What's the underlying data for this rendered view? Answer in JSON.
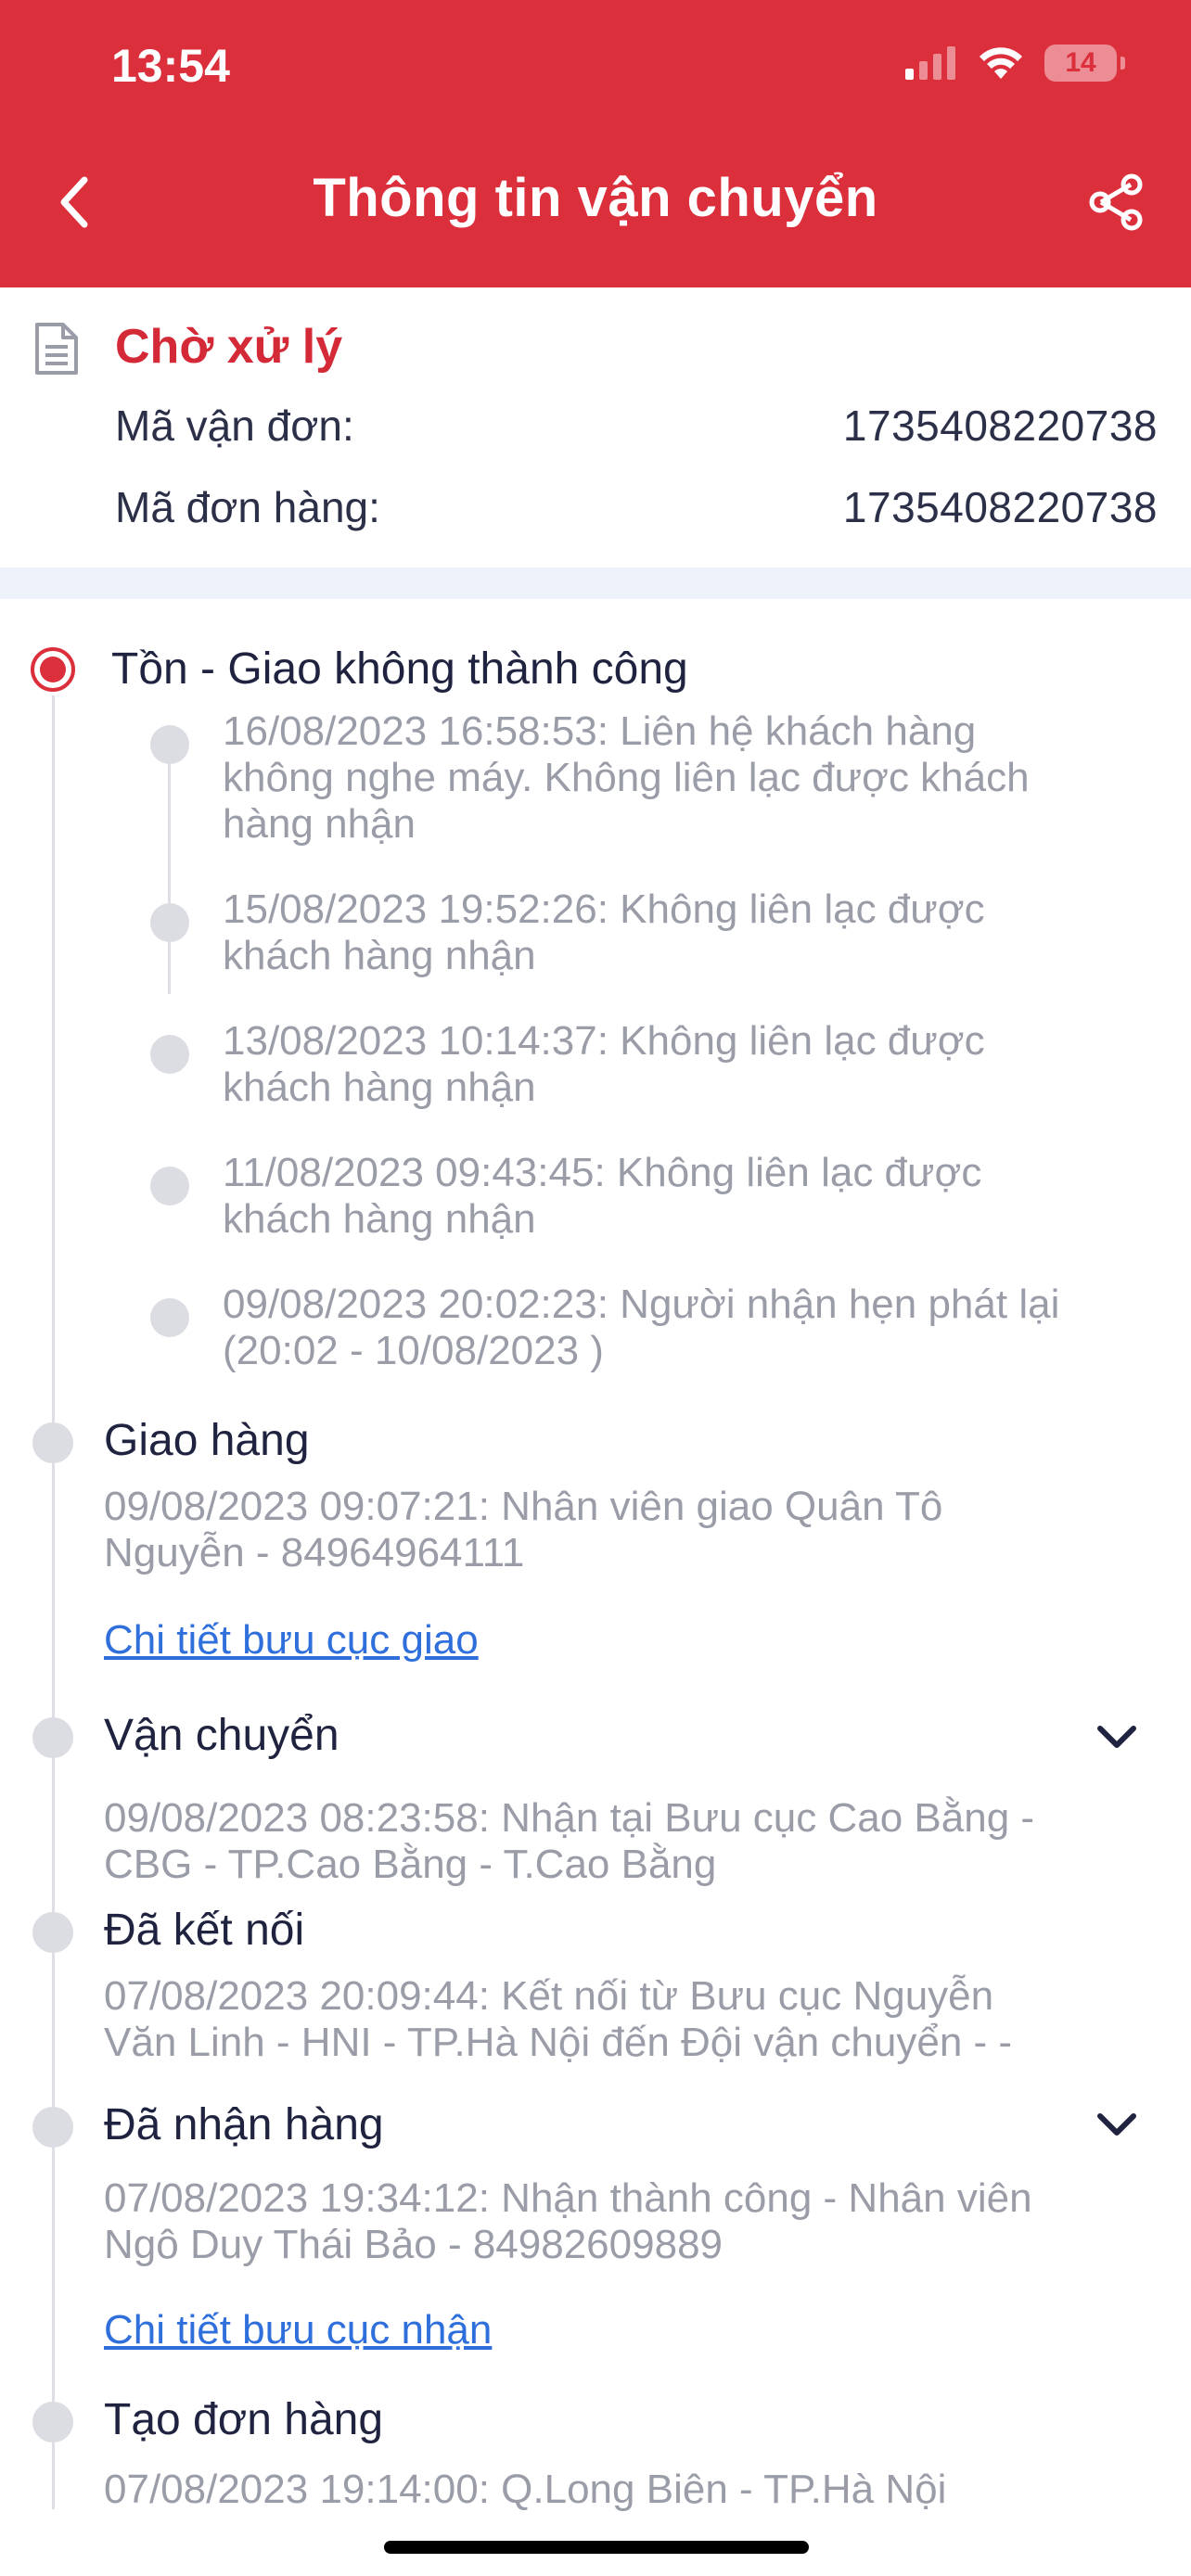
{
  "status_bar": {
    "time": "13:54",
    "battery": "14",
    "battery_level": 0.14
  },
  "header": {
    "title": "Thông tin vận chuyển",
    "accent_color": "#dc2f3c"
  },
  "order": {
    "status": "Chờ xử lý",
    "waybill_label": "Mã vận đơn:",
    "waybill_value": "1735408220738",
    "order_label": "Mã đơn hàng:",
    "order_value": "1735408220738"
  },
  "timeline": {
    "failed": {
      "title": "Tồn - Giao không thành công",
      "events": [
        {
          "line1": "16/08/2023 16:58:53: Liên hệ khách hàng",
          "line2": "không nghe máy. Không liên lạc được khách",
          "line3": "hàng nhận"
        },
        {
          "line1": "15/08/2023 19:52:26: Không liên lạc được",
          "line2": "khách hàng nhận"
        },
        {
          "line1": "13/08/2023 10:14:37: Không liên lạc được",
          "line2": "khách hàng nhận"
        },
        {
          "line1": "11/08/2023 09:43:45: Không liên lạc được",
          "line2": "khách hàng nhận"
        },
        {
          "line1": "09/08/2023 20:02:23: Người nhận hẹn phát lại",
          "line2": "(20:02 - 10/08/2023 )"
        }
      ]
    },
    "delivery": {
      "title": "Giao hàng",
      "line1": "09/08/2023 09:07:21: Nhân viên giao Quân Tô",
      "line2": "Nguyễn - 84964964111",
      "link": "Chi tiết bưu cục giao"
    },
    "transport": {
      "title": "Vận chuyển",
      "line1": "09/08/2023 08:23:58: Nhận tại Bưu cục Cao Bằng -",
      "line2": "CBG - TP.Cao Bằng - T.Cao Bằng"
    },
    "connected": {
      "title": "Đã kết nối",
      "line1": "07/08/2023 20:09:44: Kết nối từ Bưu cục Nguyễn",
      "line2": "Văn Linh - HNI - TP.Hà Nội đến Đội vận chuyển -  -"
    },
    "received": {
      "title": "Đã nhận hàng",
      "line1": "07/08/2023 19:34:12: Nhận thành công - Nhân viên",
      "line2": "Ngô Duy Thái Bảo - 84982609889",
      "link": "Chi tiết bưu cục nhận"
    },
    "created": {
      "title": "Tạo đơn hàng",
      "line1": "07/08/2023 19:14:00: Q.Long Biên - TP.Hà Nội"
    }
  }
}
